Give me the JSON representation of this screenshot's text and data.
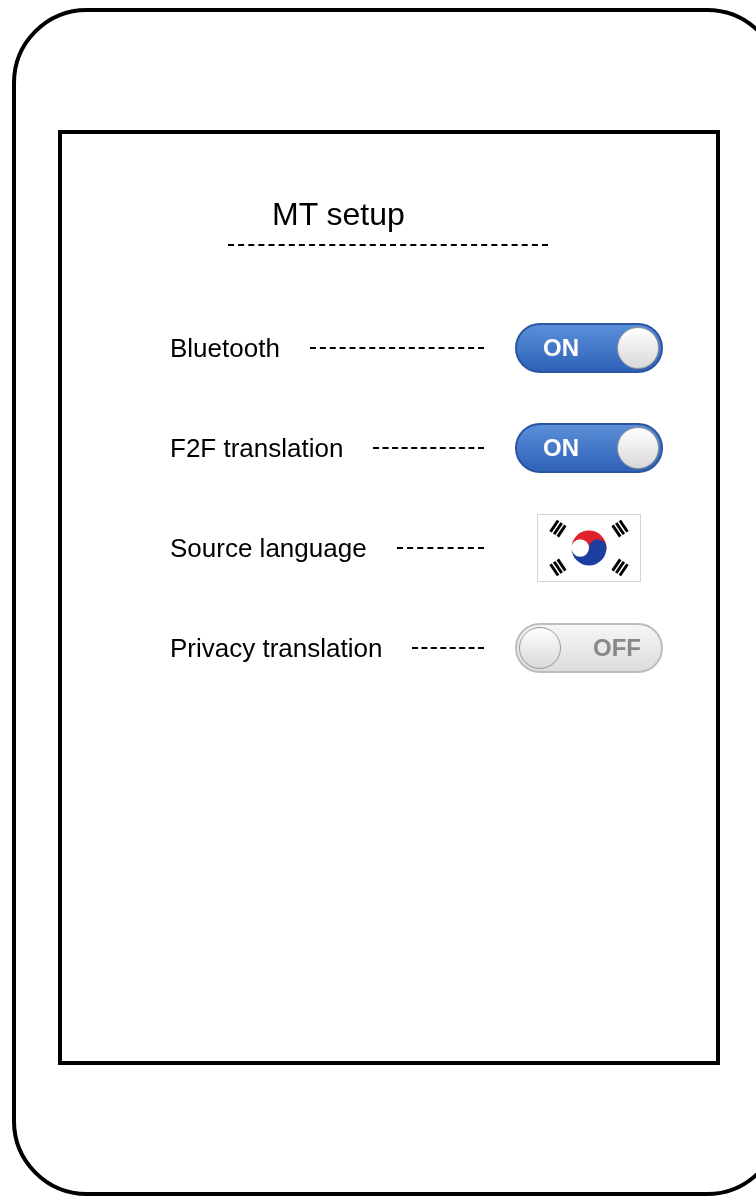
{
  "title": "MT setup",
  "settings": [
    {
      "label": "Bluetooth",
      "kind": "toggle",
      "on": true,
      "state_text": "ON"
    },
    {
      "label": "F2F translation",
      "kind": "toggle",
      "on": true,
      "state_text": "ON"
    },
    {
      "label": "Source language",
      "kind": "flag"
    },
    {
      "label": "Privacy translation",
      "kind": "toggle",
      "on": false,
      "state_text": "OFF"
    }
  ]
}
